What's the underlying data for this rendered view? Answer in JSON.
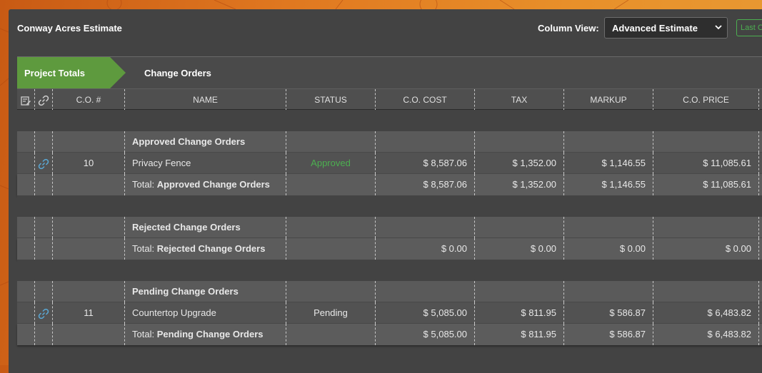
{
  "header": {
    "title": "Conway Acres Estimate",
    "column_view_label": "Column View:",
    "column_view_value": "Advanced Estimate",
    "last_button_label": "Last C"
  },
  "tabs": [
    {
      "label": "Project Totals",
      "active": true
    },
    {
      "label": "Change Orders",
      "active": false
    }
  ],
  "table": {
    "columns": [
      "C.O. #",
      "NAME",
      "STATUS",
      "C.O. COST",
      "TAX",
      "MARKUP",
      "C.O. PRICE"
    ],
    "groups": [
      {
        "title": "Approved Change Orders",
        "rows": [
          {
            "co_number": "10",
            "name": "Privacy Fence",
            "status": "Approved",
            "cost": "$ 8,587.06",
            "tax": "$ 1,352.00",
            "markup": "$ 1,146.55",
            "price": "$ 11,085.61"
          }
        ],
        "total": {
          "prefix": "Total:",
          "label": "Approved Change Orders",
          "cost": "$ 8,587.06",
          "tax": "$ 1,352.00",
          "markup": "$ 1,146.55",
          "price": "$ 11,085.61"
        }
      },
      {
        "title": "Rejected Change Orders",
        "rows": [],
        "total": {
          "prefix": "Total:",
          "label": "Rejected Change Orders",
          "cost": "$ 0.00",
          "tax": "$ 0.00",
          "markup": "$ 0.00",
          "price": "$ 0.00"
        }
      },
      {
        "title": "Pending Change Orders",
        "rows": [
          {
            "co_number": "11",
            "name": "Countertop Upgrade",
            "status": "Pending",
            "cost": "$ 5,085.00",
            "tax": "$ 811.95",
            "markup": "$ 586.87",
            "price": "$ 6,483.82"
          }
        ],
        "total": {
          "prefix": "Total:",
          "label": "Pending Change Orders",
          "cost": "$ 5,085.00",
          "tax": "$ 811.95",
          "markup": "$ 586.87",
          "price": "$ 6,483.82"
        }
      }
    ]
  },
  "colors": {
    "accent_green": "#4caf50",
    "tab_active": "#5e9a3e",
    "link_icon": "#5aa9d6"
  }
}
